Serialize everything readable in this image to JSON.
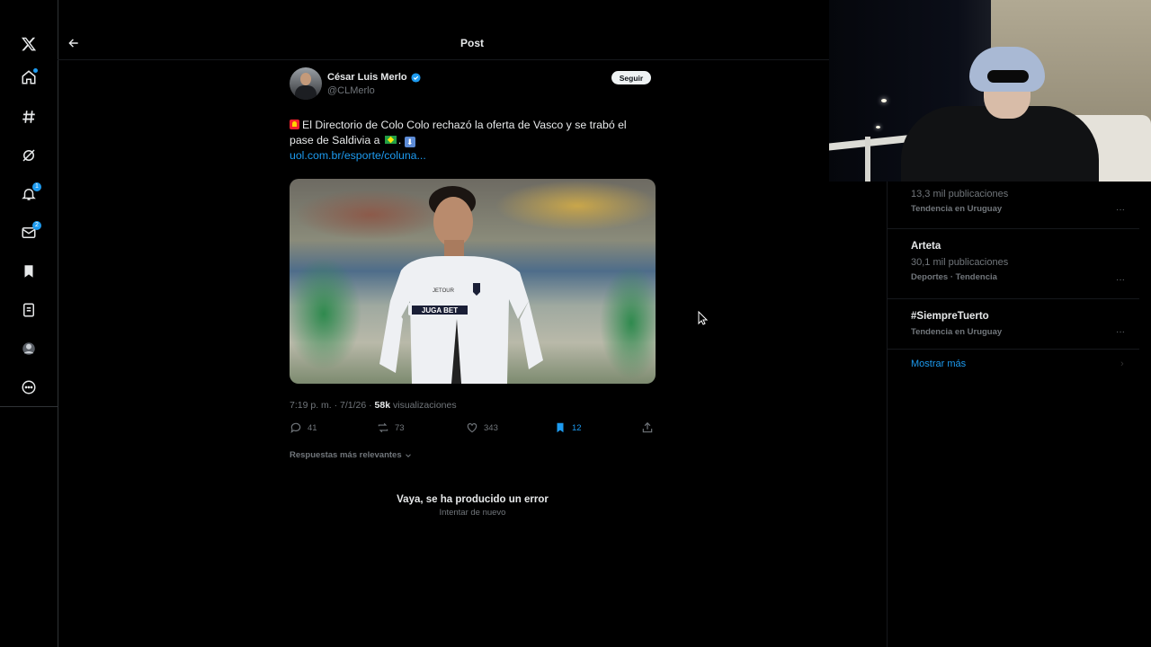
{
  "header": {
    "title": "Post"
  },
  "rail": {
    "notifications_badge": "1",
    "messages_badge": "2"
  },
  "post": {
    "author_name": "César Luis Merlo",
    "handle": "@CLMerlo",
    "follow_label": "Seguir",
    "text_part1": "El Directorio de Colo Colo rechazó la oferta de Vasco y se trabó el pase de Saldivia a",
    "text_part2": ".",
    "link": "uol.com.br/esporte/coluna...",
    "timestamp": "7:19 p. m. · 7/1/26 · ",
    "views_count": "58k",
    "views_label": " visualizaciones",
    "replies": "41",
    "reposts": "73",
    "likes": "343",
    "bookmarks": "12",
    "jersey_sponsor": "JUGA BET",
    "jersey_sleeve": "JETOUR"
  },
  "replies_section": {
    "sort_label": "Respuestas más relevantes",
    "error_title": "Vaya, se ha producido un error",
    "retry_label": "Intentar de nuevo"
  },
  "trends": [
    {
      "count": "13,3 mil publicaciones",
      "context": "Tendencia en Uruguay"
    },
    {
      "name": "Arteta",
      "count": "30,1 mil publicaciones",
      "context": "Deportes · Tendencia"
    },
    {
      "name": "#SiempreTuerto",
      "context": "Tendencia en Uruguay"
    }
  ],
  "show_more": "Mostrar más",
  "colors": {
    "accent": "#1d9bf0",
    "background": "#000000",
    "text": "#e7e9ea",
    "muted": "#71767b"
  }
}
